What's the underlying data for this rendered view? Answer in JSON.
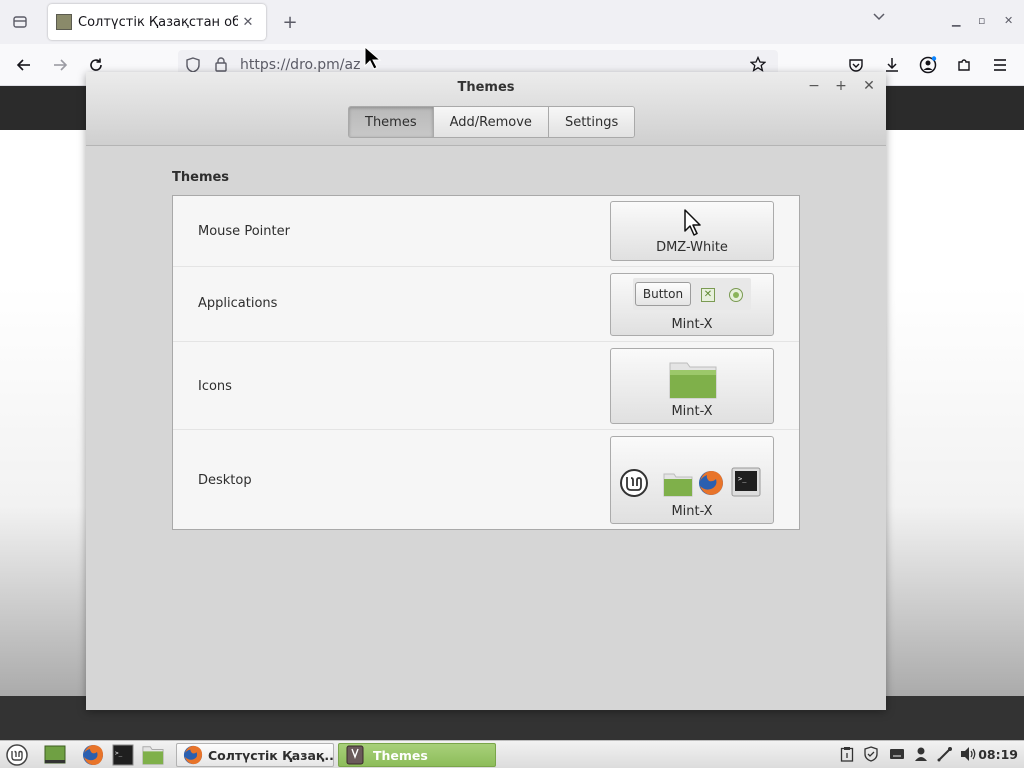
{
  "browser": {
    "tab_title": "Солтүстік Қазақстан облы",
    "url": "https://dro.pm/az"
  },
  "dialog": {
    "title": "Themes",
    "stack": [
      {
        "label": "Themes",
        "active": true
      },
      {
        "label": "Add/Remove",
        "active": false
      },
      {
        "label": "Settings",
        "active": false
      }
    ],
    "section_title": "Themes",
    "rows": [
      {
        "label": "Mouse Pointer",
        "value": "DMZ-White"
      },
      {
        "label": "Applications",
        "value": "Mint-X",
        "preview_button": "Button"
      },
      {
        "label": "Icons",
        "value": "Mint-X"
      },
      {
        "label": "Desktop",
        "value": "Mint-X"
      }
    ]
  },
  "taskbar": {
    "windows": [
      {
        "label": "Солтүстік Қазақ...",
        "active": false
      },
      {
        "label": "Themes",
        "active": true
      }
    ],
    "clock": "08:19"
  },
  "colors": {
    "mint_green": "#8dbd5a",
    "dialog_bg": "#d6d6d6"
  }
}
